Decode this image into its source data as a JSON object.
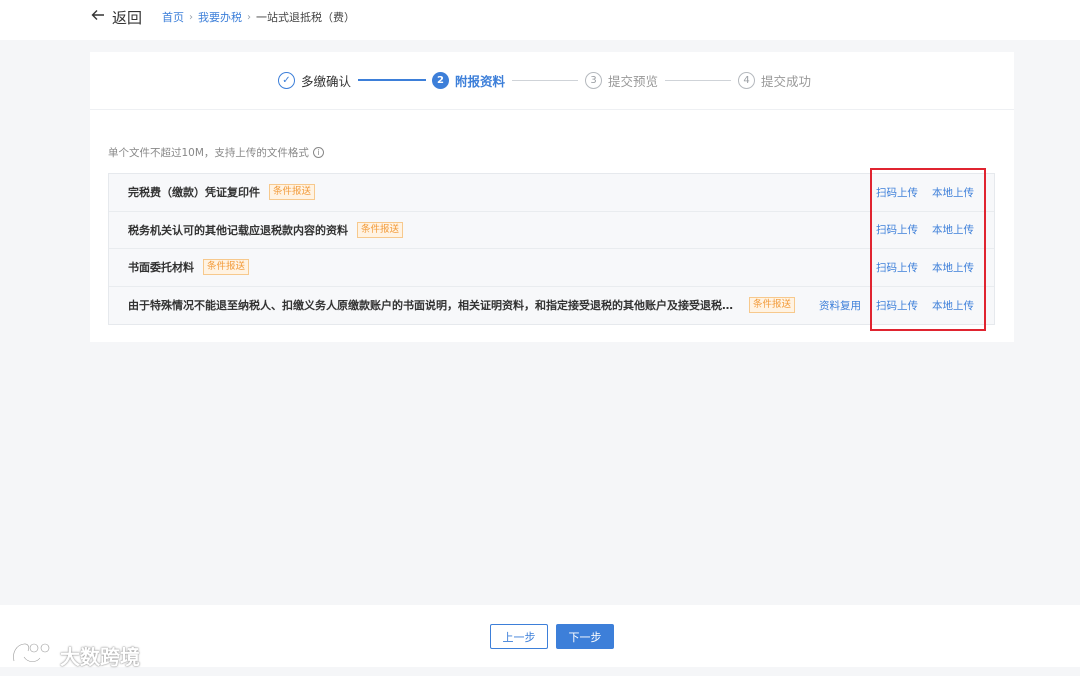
{
  "header": {
    "back_label": "返回",
    "breadcrumb": {
      "home": "首页",
      "section": "我要办税",
      "current": "一站式退抵税（费）",
      "separator": "›"
    }
  },
  "steps": [
    {
      "index": "✓",
      "label": "多缴确认",
      "state": "done"
    },
    {
      "index": "2",
      "label": "附报资料",
      "state": "active"
    },
    {
      "index": "3",
      "label": "提交预览",
      "state": "pending"
    },
    {
      "index": "4",
      "label": "提交成功",
      "state": "pending"
    }
  ],
  "hint": {
    "text": "单个文件不超过10M，支持上传的文件格式",
    "icon": "i"
  },
  "materials": [
    {
      "title": "完税费（缴款）凭证复印件",
      "tag": "条件报送",
      "scan": "扫码上传",
      "local": "本地上传"
    },
    {
      "title": "税务机关认可的其他记载应退税款内容的资料",
      "tag": "条件报送",
      "scan": "扫码上传",
      "local": "本地上传"
    },
    {
      "title": "书面委托材料",
      "tag": "条件报送",
      "scan": "扫码上传",
      "local": "本地上传"
    },
    {
      "title": "由于特殊情况不能退至纳税人、扣缴义务人原缴款账户的书面说明，相关证明资料，和指定接受退税的其他账户及接受退税单...",
      "tag": "条件报送",
      "reuse": "资料复用",
      "scan": "扫码上传",
      "local": "本地上传"
    }
  ],
  "footer": {
    "prev_label": "上一步",
    "next_label": "下一步"
  },
  "watermark": {
    "text": "大数跨境"
  },
  "colors": {
    "accent": "#3d7fd9",
    "tag": "#f29b3a",
    "highlight": "#e02430"
  }
}
